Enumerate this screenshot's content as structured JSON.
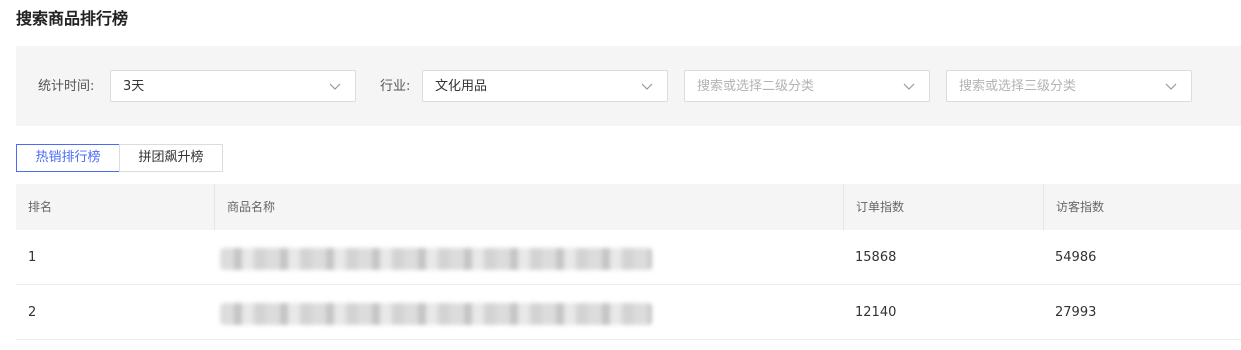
{
  "page": {
    "title": "搜索商品排行榜"
  },
  "filters": {
    "time_label": "统计时间:",
    "time_value": "3天",
    "industry_label": "行业:",
    "industry_value": "文化用品",
    "second_category_placeholder": "搜索或选择二级分类",
    "third_category_placeholder": "搜索或选择三级分类",
    "chevron_icon": "chevron-down-icon"
  },
  "tabs": [
    {
      "label": "热销排行榜",
      "active": true
    },
    {
      "label": "拼团飙升榜",
      "active": false
    }
  ],
  "table": {
    "headers": [
      "排名",
      "商品名称",
      "订单指数",
      "访客指数"
    ],
    "rows": [
      {
        "rank": "1",
        "product": "",
        "order_index": "15868",
        "visitor_index": "54986"
      },
      {
        "rank": "2",
        "product": "",
        "order_index": "12140",
        "visitor_index": "27993"
      }
    ]
  },
  "colors": {
    "accent": "#4a6cf7",
    "panel_bg": "#f5f5f5",
    "border": "#dcdcdc"
  }
}
